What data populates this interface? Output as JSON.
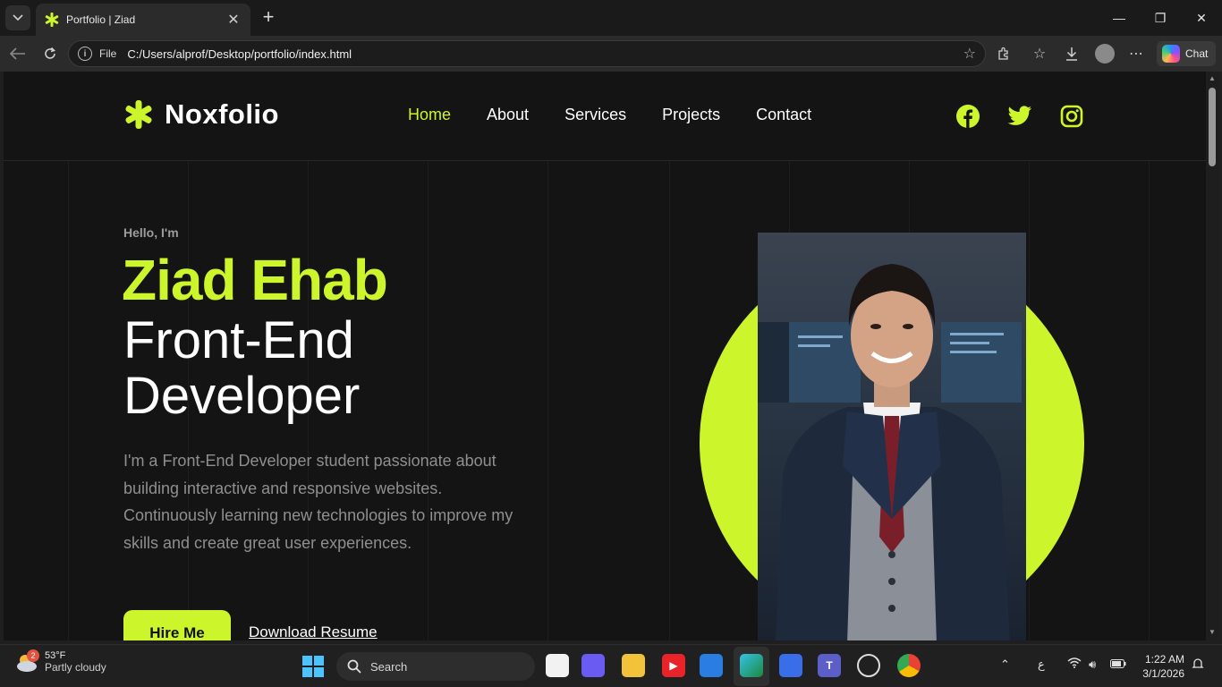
{
  "browser": {
    "tab_title": "Portfolio | Ziad",
    "url_scheme": "File",
    "url": "C:/Users/alprof/Desktop/portfolio/index.html",
    "chat_label": "Chat"
  },
  "site": {
    "logo_text": "Noxfolio",
    "nav": [
      "Home",
      "About",
      "Services",
      "Projects",
      "Contact"
    ],
    "active_nav": "Home",
    "socials": [
      "facebook-icon",
      "twitter-icon",
      "instagram-icon"
    ]
  },
  "hero": {
    "eyebrow": "Hello, I'm",
    "name": "Ziad Ehab",
    "role": "Front-End Developer",
    "description": "I'm a Front-End Developer student passionate about building interactive and responsive websites. Continuously learning new technologies to improve my skills and create great user experiences.",
    "hire_label": "Hire Me",
    "resume_label": "Download Resume"
  },
  "taskbar": {
    "weather_badge": "2",
    "weather_temp": "53°F",
    "weather_condition": "Partly cloudy",
    "search_label": "Search",
    "language": "ع",
    "time": "1:22 AM",
    "date": "3/1/2026"
  },
  "colors": {
    "accent": "#cdf52b",
    "page_bg": "#141414",
    "text_muted": "#8f8f8f"
  }
}
